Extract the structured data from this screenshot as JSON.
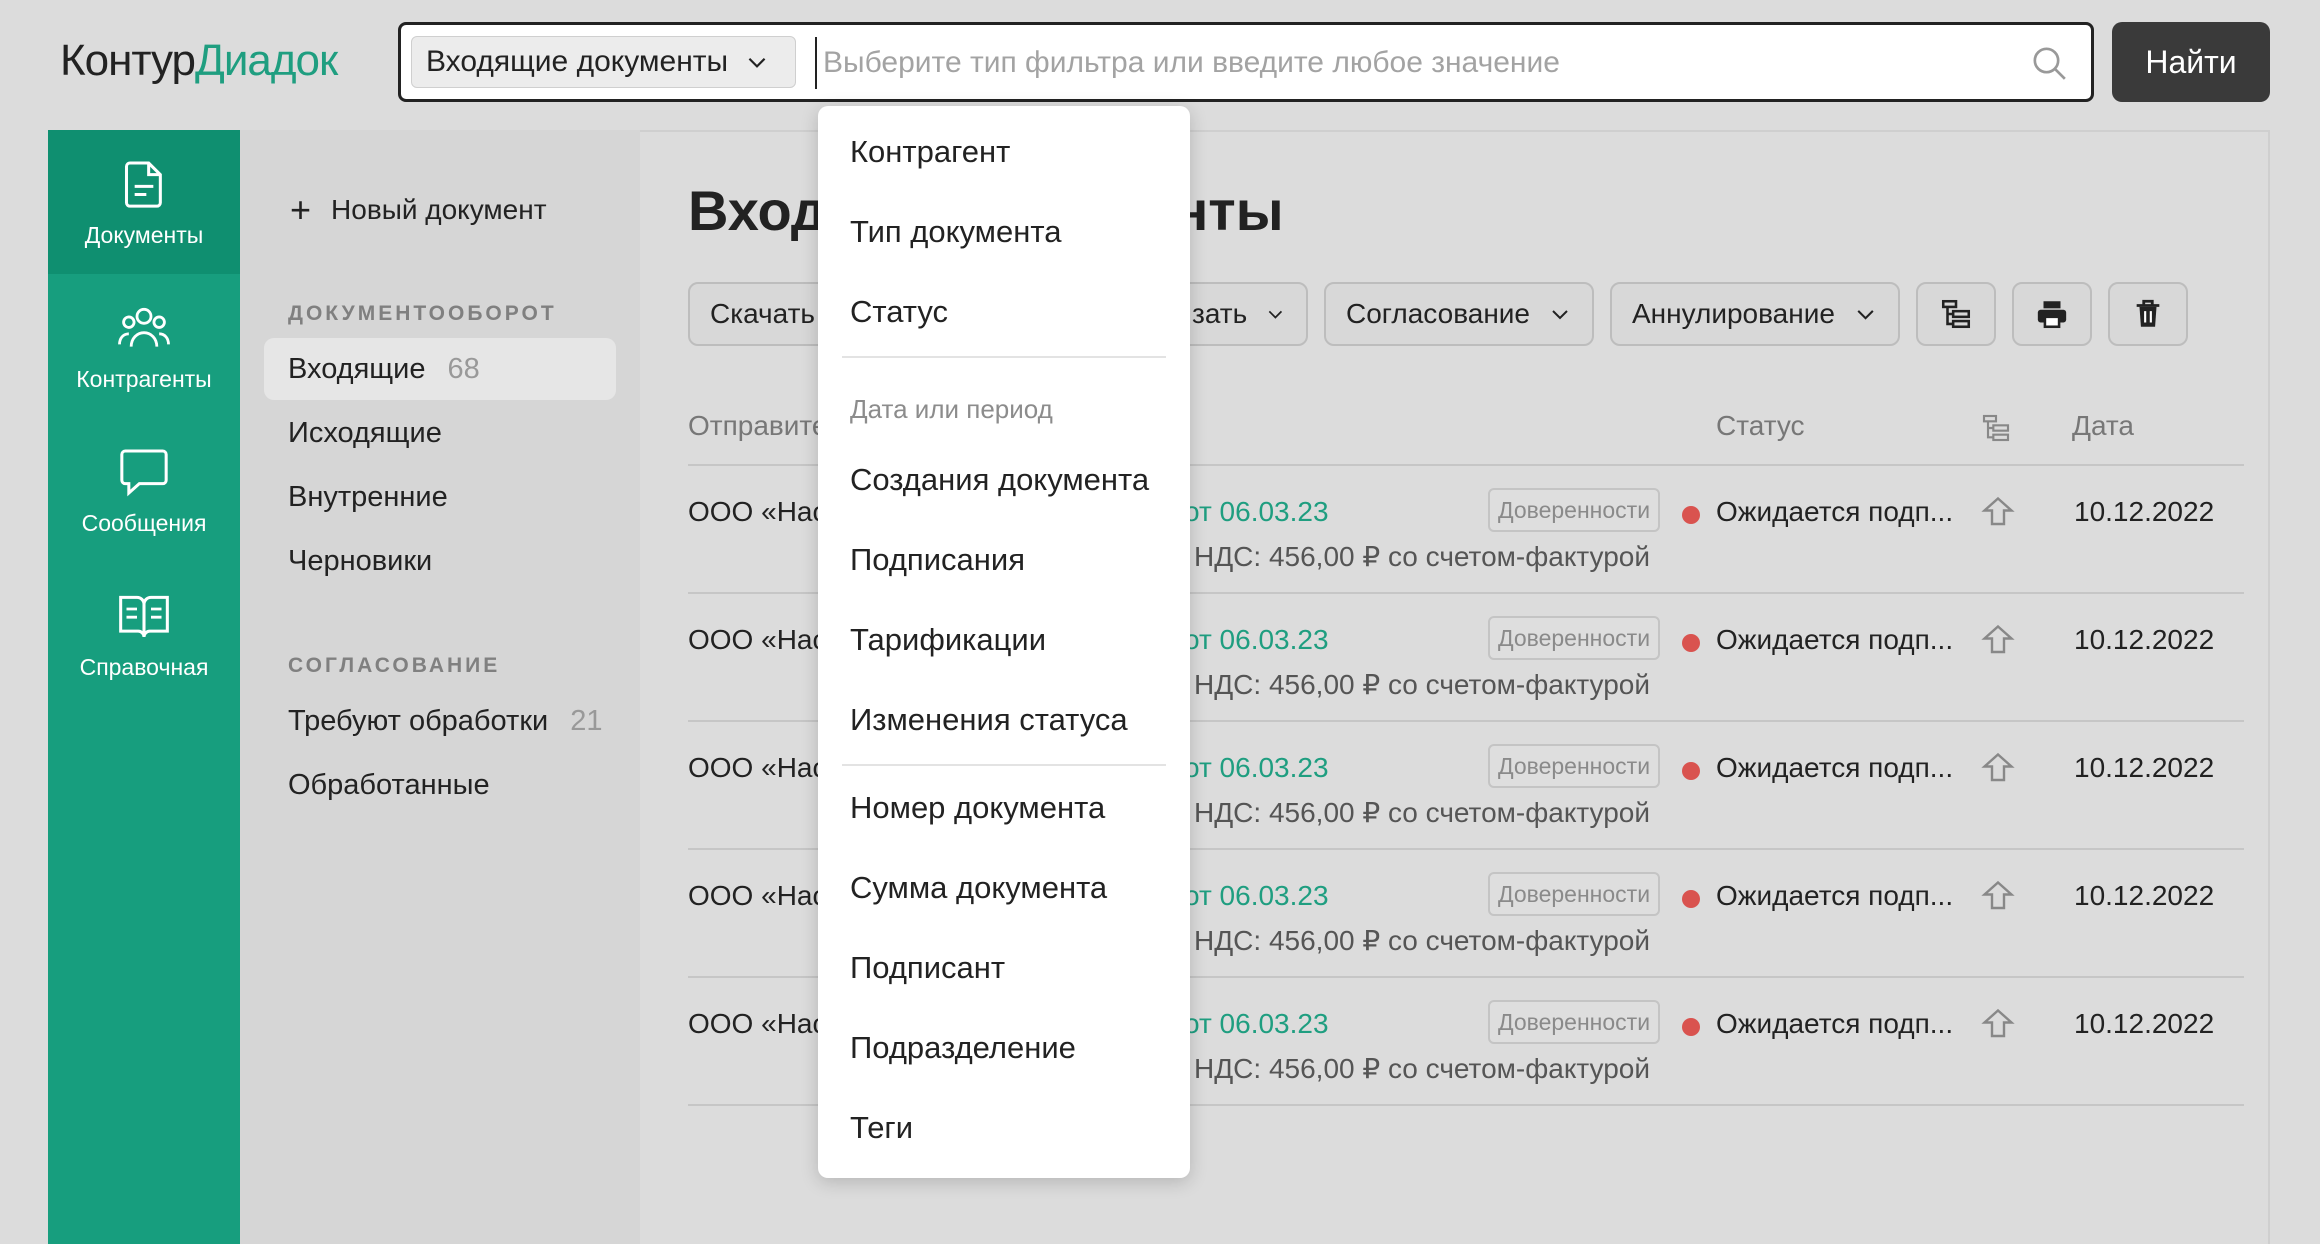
{
  "logo": {
    "part1": "Контур",
    "part2": "Диадок"
  },
  "search": {
    "doc_type": "Входящие документы",
    "placeholder": "Выберите тип фильтра или введите любое значение",
    "button": "Найти"
  },
  "rail": [
    {
      "label": "Документы",
      "icon": "document-icon",
      "active": true
    },
    {
      "label": "Контрагенты",
      "icon": "people-icon",
      "active": false
    },
    {
      "label": "Сообщения",
      "icon": "chat-icon",
      "active": false
    },
    {
      "label": "Справочная",
      "icon": "book-icon",
      "active": false
    }
  ],
  "sidebar": {
    "new_doc": "Новый документ",
    "section1": "ДОКУМЕНТООБОРОТ",
    "items1": [
      {
        "label": "Входящие",
        "count": "68"
      },
      {
        "label": "Исходящие",
        "count": ""
      },
      {
        "label": "Внутренние",
        "count": ""
      },
      {
        "label": "Черновики",
        "count": ""
      }
    ],
    "section2": "СОГЛАСОВАНИЕ",
    "items2": [
      {
        "label": "Требуют обработки",
        "count": "21"
      },
      {
        "label": "Обработанные",
        "count": ""
      }
    ]
  },
  "main": {
    "title_left": "Вход",
    "title_right": "нты",
    "toolbar": {
      "download": "Скачать",
      "sign_partial": "зать",
      "approval": "Согласование",
      "annul": "Аннулирование"
    },
    "columns": {
      "sender": "Отправите",
      "status": "Статус",
      "date": "Дата"
    },
    "rows": [
      {
        "sender": "ООО «Нас",
        "doc_date": "от 06.03.23",
        "desc": "НДС: 456,00 ₽ со счетом-фактурой",
        "tag": "Доверенности",
        "status": "Ожидается подп...",
        "date": "10.12.2022"
      },
      {
        "sender": "ООО «Нас",
        "doc_date": "от 06.03.23",
        "desc": "НДС: 456,00 ₽ со счетом-фактурой",
        "tag": "Доверенности",
        "status": "Ожидается подп...",
        "date": "10.12.2022"
      },
      {
        "sender": "ООО «Нас",
        "doc_date": "от 06.03.23",
        "desc": "НДС: 456,00 ₽ со счетом-фактурой",
        "tag": "Доверенности",
        "status": "Ожидается подп...",
        "date": "10.12.2022"
      },
      {
        "sender": "ООО «Нас",
        "doc_date": "от 06.03.23",
        "desc": "НДС: 456,00 ₽ со счетом-фактурой",
        "tag": "Доверенности",
        "status": "Ожидается подп...",
        "date": "10.12.2022"
      },
      {
        "sender": "ООО «Нас",
        "doc_date": "от 06.03.23",
        "desc": "НДС: 456,00 ₽ со счетом-фактурой",
        "tag": "Доверенности",
        "status": "Ожидается подп...",
        "date": "10.12.2022"
      }
    ],
    "status_color": "#d9534f"
  },
  "dropdown": {
    "items_a": [
      "Контрагент",
      "Тип документа",
      "Статус"
    ],
    "group": "Дата или период",
    "items_b": [
      "Создания документа",
      "Подписания",
      "Тарификации",
      "Изменения статуса"
    ],
    "items_c": [
      "Номер документа",
      "Сумма документа",
      "Подписант",
      "Подразделение",
      "Теги"
    ]
  },
  "colors": {
    "accent": "#1f9e80",
    "rail": "#179e7e",
    "button_dark": "#3a3a3a"
  }
}
